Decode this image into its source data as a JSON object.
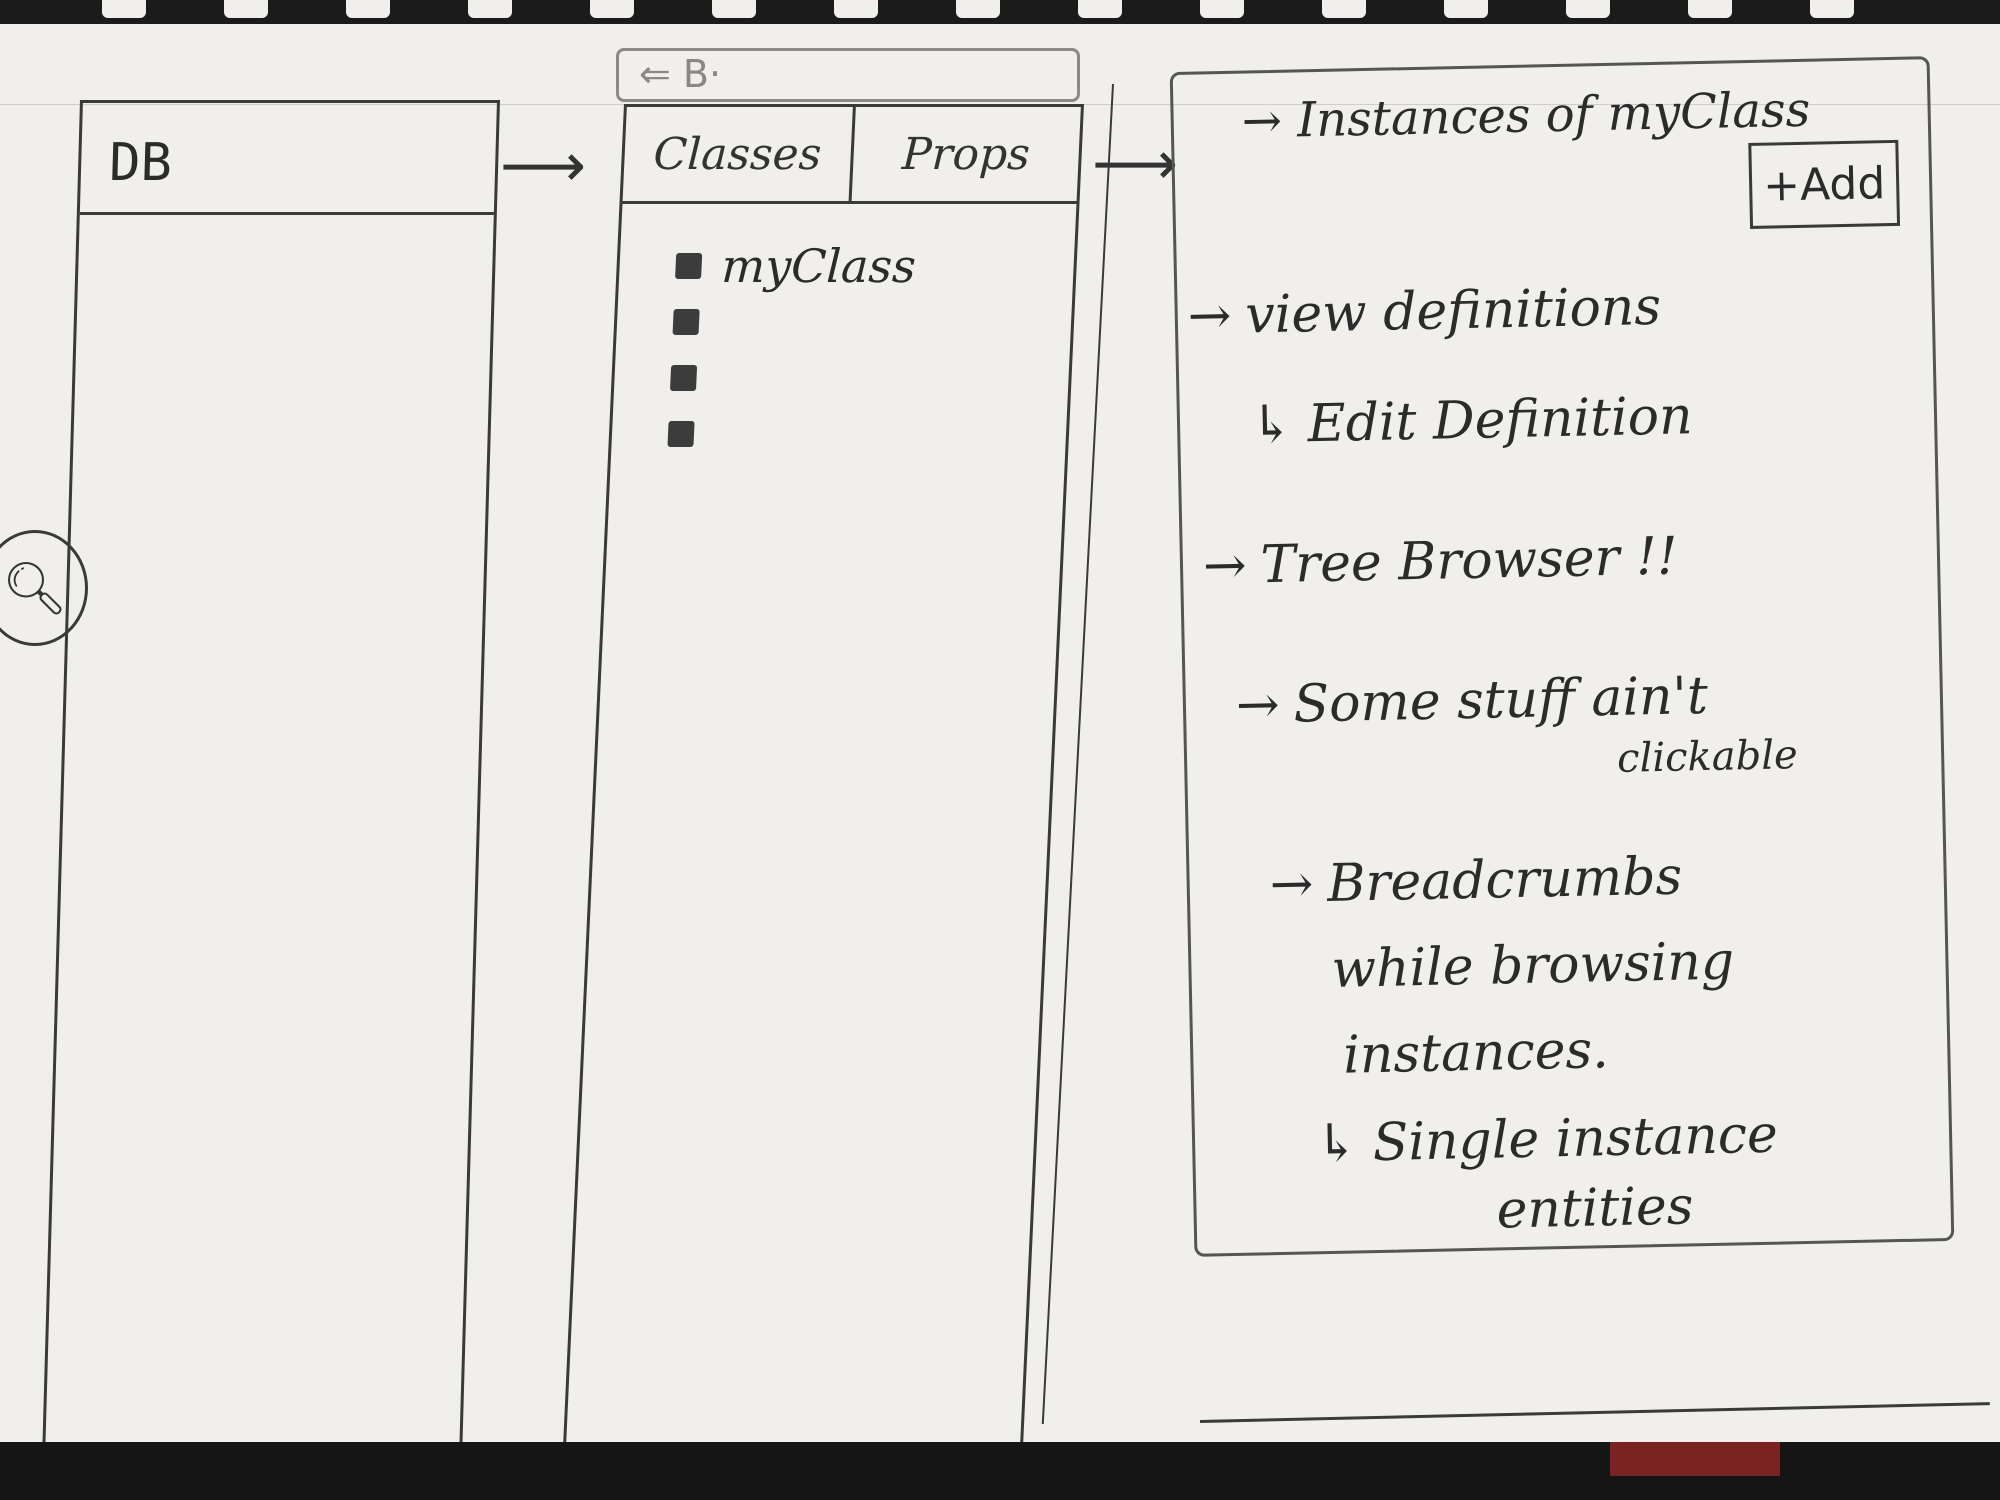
{
  "db_panel": {
    "title": "DB"
  },
  "breadcrumb": {
    "text": "⇐ B·"
  },
  "classes_panel": {
    "tabs": [
      {
        "label": "Classes"
      },
      {
        "label": "Props"
      }
    ],
    "items": [
      {
        "label": "myClass"
      },
      {
        "label": ""
      },
      {
        "label": ""
      },
      {
        "label": ""
      }
    ]
  },
  "notes_panel": {
    "title": "Instances of myClass",
    "add_label": "+Add",
    "notes": [
      "view definitions",
      "Edit Definition",
      "Tree Browser !!",
      "Some stuff ain't",
      "clickable",
      "Breadcrumbs",
      "while browsing",
      "instances.",
      "Single instance",
      "entities"
    ]
  },
  "icons": {
    "search": "search-icon"
  }
}
